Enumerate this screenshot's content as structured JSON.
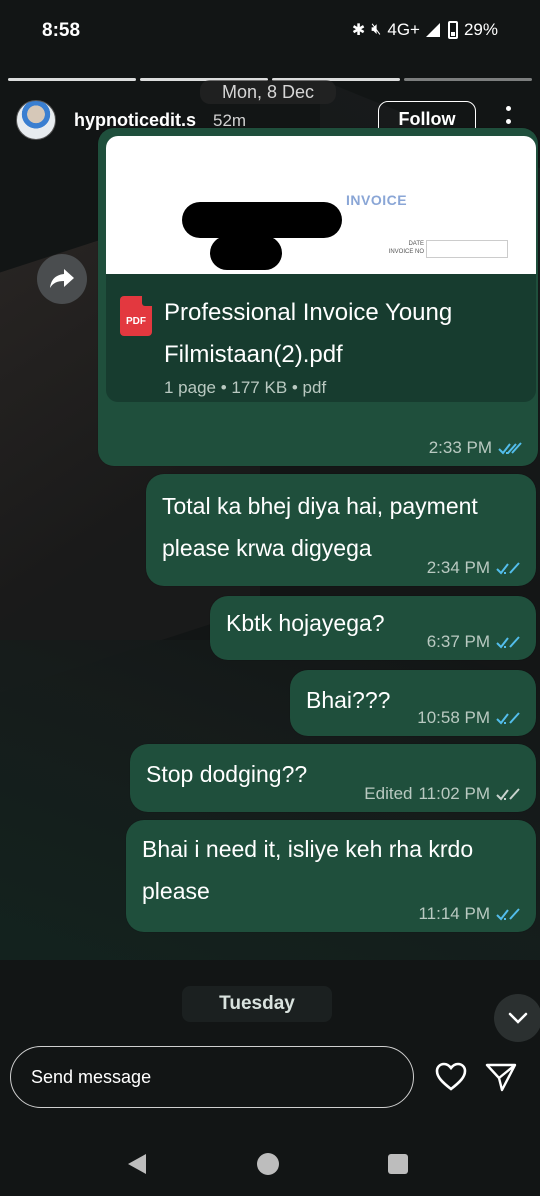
{
  "status_bar": {
    "time": "8:58",
    "network": "4G+",
    "battery": "29%"
  },
  "story": {
    "date_label": "Mon, 8 Dec"
  },
  "header": {
    "username": "hypnoticedit.s",
    "age": "52m",
    "follow_label": "Follow"
  },
  "document": {
    "preview_title": "INVOICE",
    "icon_label": "PDF",
    "file_name": "Professional Invoice Young Filmistaan(2).pdf",
    "meta": "1 page • 177 KB • pdf",
    "time": "2:33 PM"
  },
  "messages": [
    {
      "text": "Total ka bhej diya hai, payment please krwa digyega",
      "time": "2:34 PM",
      "edited": "",
      "read": true
    },
    {
      "text": "Kbtk hojayega?",
      "time": "6:37 PM",
      "edited": "",
      "read": true
    },
    {
      "text": "Bhai???",
      "time": "10:58 PM",
      "edited": "",
      "read": true
    },
    {
      "text": "Stop dodging??",
      "time": "11:02 PM",
      "edited": "Edited",
      "read": false
    },
    {
      "text": "Bhai i need it, isliye keh rha krdo please",
      "time": "11:14 PM",
      "edited": "",
      "read": true
    }
  ],
  "divider": {
    "day_label": "Tuesday"
  },
  "composer": {
    "placeholder": "Send message"
  },
  "colors": {
    "bubble": "#1f4f3c",
    "read_tick": "#53bdeb",
    "unread_tick": "#c9d3ce"
  }
}
